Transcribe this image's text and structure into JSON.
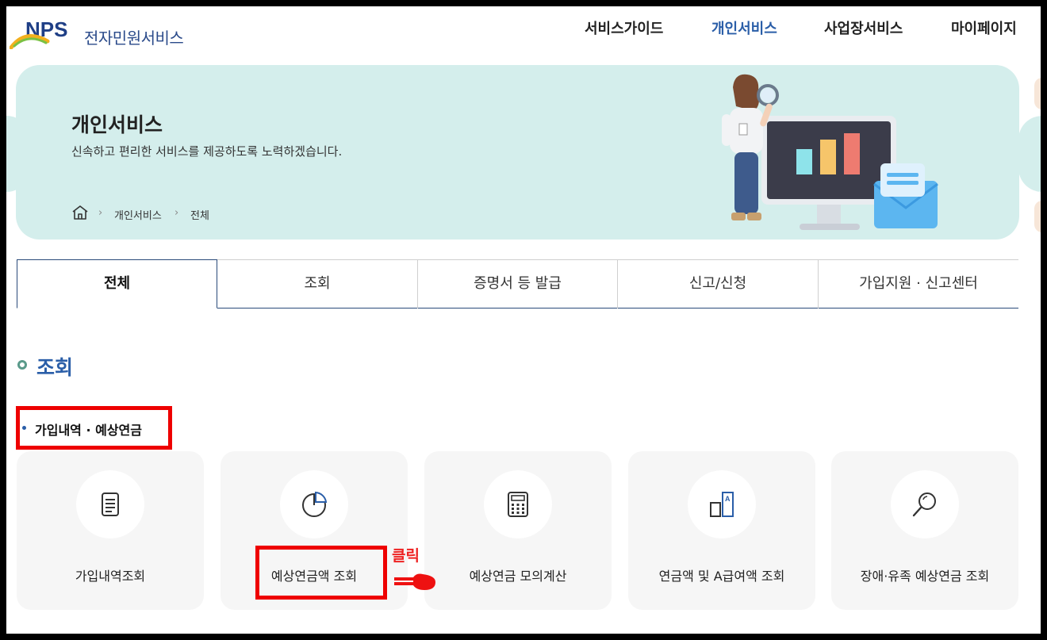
{
  "header": {
    "logo_text": "NPS",
    "service_name": "전자민원서비스",
    "nav": [
      "서비스가이드",
      "개인서비스",
      "사업장서비스",
      "마이페이지"
    ],
    "nav_active": "개인서비스"
  },
  "banner": {
    "title": "개인서비스",
    "subtitle": "신속하고 편리한 서비스를 제공하도록 노력하겠습니다.",
    "breadcrumb": [
      "개인서비스",
      "전체"
    ]
  },
  "tabs": [
    "전체",
    "조회",
    "증명서 등 발급",
    "신고/신청",
    "가입지원 · 신고센터"
  ],
  "active_tab": "전체",
  "section": {
    "title": "조회",
    "subsection": "가입내역 · 예상연금"
  },
  "cards": [
    {
      "label": "가입내역조회",
      "icon": "document-icon"
    },
    {
      "label": "예상연금액 조회",
      "icon": "pie-chart-icon"
    },
    {
      "label": "예상연금 모의계산",
      "icon": "calculator-icon"
    },
    {
      "label": "연금액 및 A급여액 조회",
      "icon": "bar-a-icon"
    },
    {
      "label": "장애·유족 예상연금 조회",
      "icon": "magnifier-icon"
    }
  ],
  "annotation": {
    "click_label": "클릭"
  },
  "colors": {
    "brand_blue": "#2a5ea8",
    "banner_bg": "#d4eeec",
    "highlight_red": "#ee0000",
    "card_bg": "#f6f6f6"
  }
}
